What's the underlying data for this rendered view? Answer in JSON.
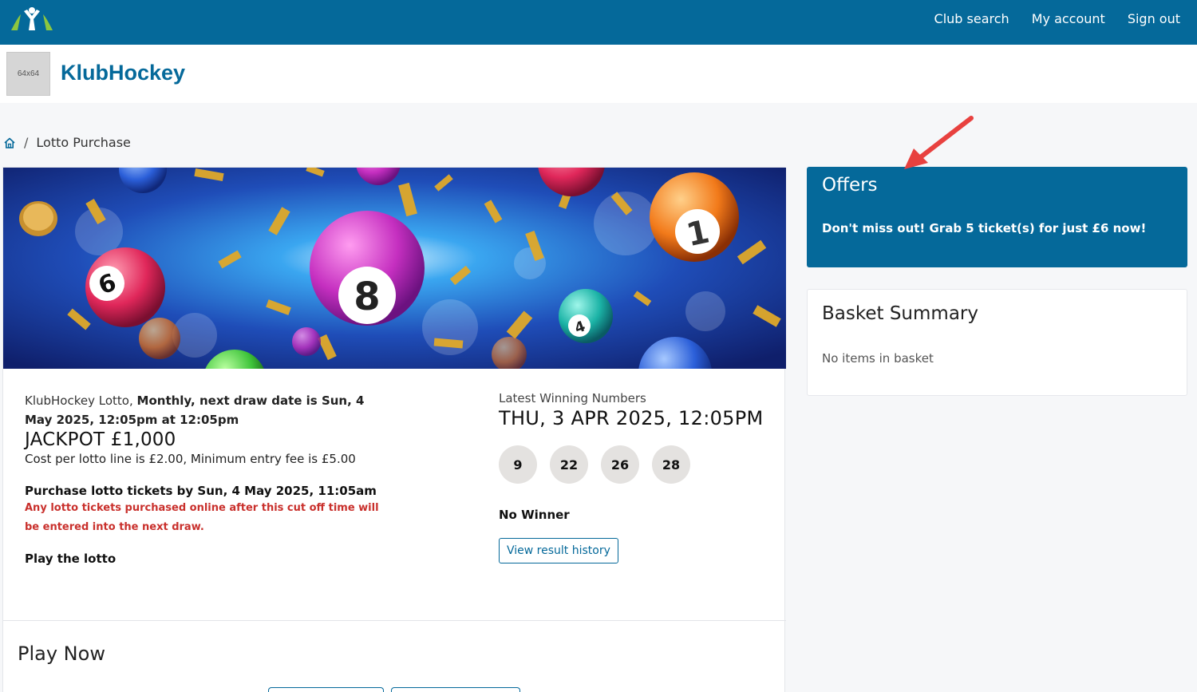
{
  "nav": {
    "links": [
      "Club search",
      "My account",
      "Sign out"
    ]
  },
  "club": {
    "placeholder": "64x64",
    "name": "KlubHockey"
  },
  "breadcrumb": {
    "separator": "/",
    "current": "Lotto Purchase"
  },
  "lotto": {
    "draw_prefix": "KlubHockey Lotto,",
    "draw_detail": "Monthly, next draw date is Sun, 4 May 2025, 12:05pm at 12:05pm",
    "jackpot": "JACKPOT £1,000",
    "cost": "Cost per lotto line is £2.00, Minimum entry fee is £5.00",
    "cutoff_title": "Purchase lotto tickets by Sun, 4 May 2025, 11:05am",
    "cutoff_warning": "Any lotto tickets purchased online after this cut off time will be entered into the next draw.",
    "play_label": "Play the lotto"
  },
  "latest": {
    "label": "Latest Winning Numbers",
    "date": "THU, 3 APR 2025, 12:05PM",
    "numbers": [
      "9",
      "22",
      "26",
      "28"
    ],
    "result": "No Winner",
    "history_button": "View result history"
  },
  "play_now": {
    "title": "Play Now"
  },
  "offers": {
    "title": "Offers",
    "text": "Don't miss out! Grab 5 ticket(s) for just £6 now!"
  },
  "basket": {
    "title": "Basket Summary",
    "empty": "No items in basket"
  },
  "colors": {
    "primary": "#05699a",
    "warning": "#c9302c",
    "annotation_arrow": "#e8413f"
  }
}
